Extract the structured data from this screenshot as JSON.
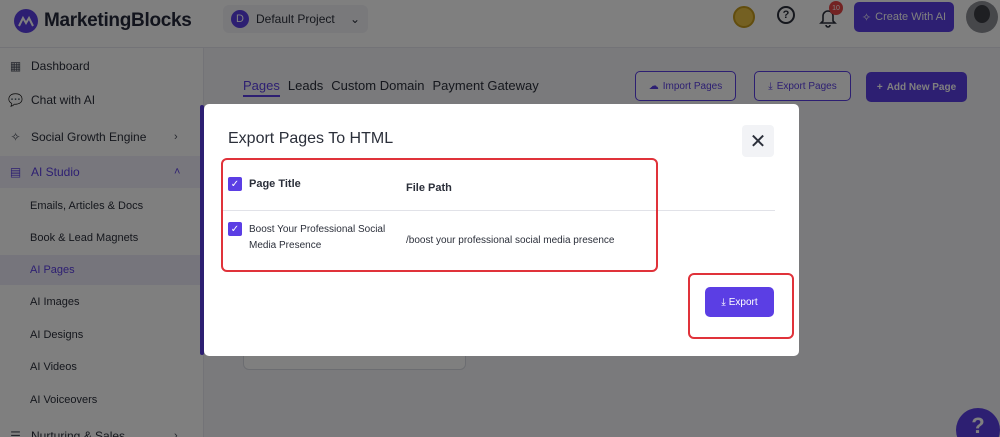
{
  "brand": {
    "name": "MarketingBlocks"
  },
  "header": {
    "project_initial": "D",
    "project_name": "Default Project",
    "notification_count": "10",
    "create_label": "Create With AI"
  },
  "sidebar": {
    "items": [
      {
        "label": "Dashboard",
        "icon": "grid-icon"
      },
      {
        "label": "Chat with AI",
        "icon": "chat-icon"
      },
      {
        "label": "Social Growth Engine",
        "icon": "magic-wand-icon"
      },
      {
        "label": "AI Studio",
        "icon": "archive-icon"
      }
    ],
    "studio_items": [
      "Emails, Articles & Docs",
      "Book & Lead Magnets",
      "AI Pages",
      "AI Images",
      "AI Designs",
      "AI Videos",
      "AI Voiceovers"
    ],
    "last_item": "Nurturing & Sales"
  },
  "main": {
    "tabs": [
      "Pages",
      "Leads",
      "Custom Domain",
      "Payment Gateway"
    ],
    "import_label": "Import Pages",
    "export_label": "Export Pages",
    "add_label": "Add New Page"
  },
  "modal": {
    "title": "Export Pages To HTML",
    "col_title": "Page Title",
    "col_path": "File Path",
    "rows": [
      {
        "title": "Boost Your Professional Social Media Presence",
        "path": "/boost your professional social media presence"
      }
    ],
    "export_label": "Export"
  },
  "help": {
    "label": "?"
  },
  "colors": {
    "accent": "#5b3ee4",
    "highlight": "#e0323a"
  }
}
